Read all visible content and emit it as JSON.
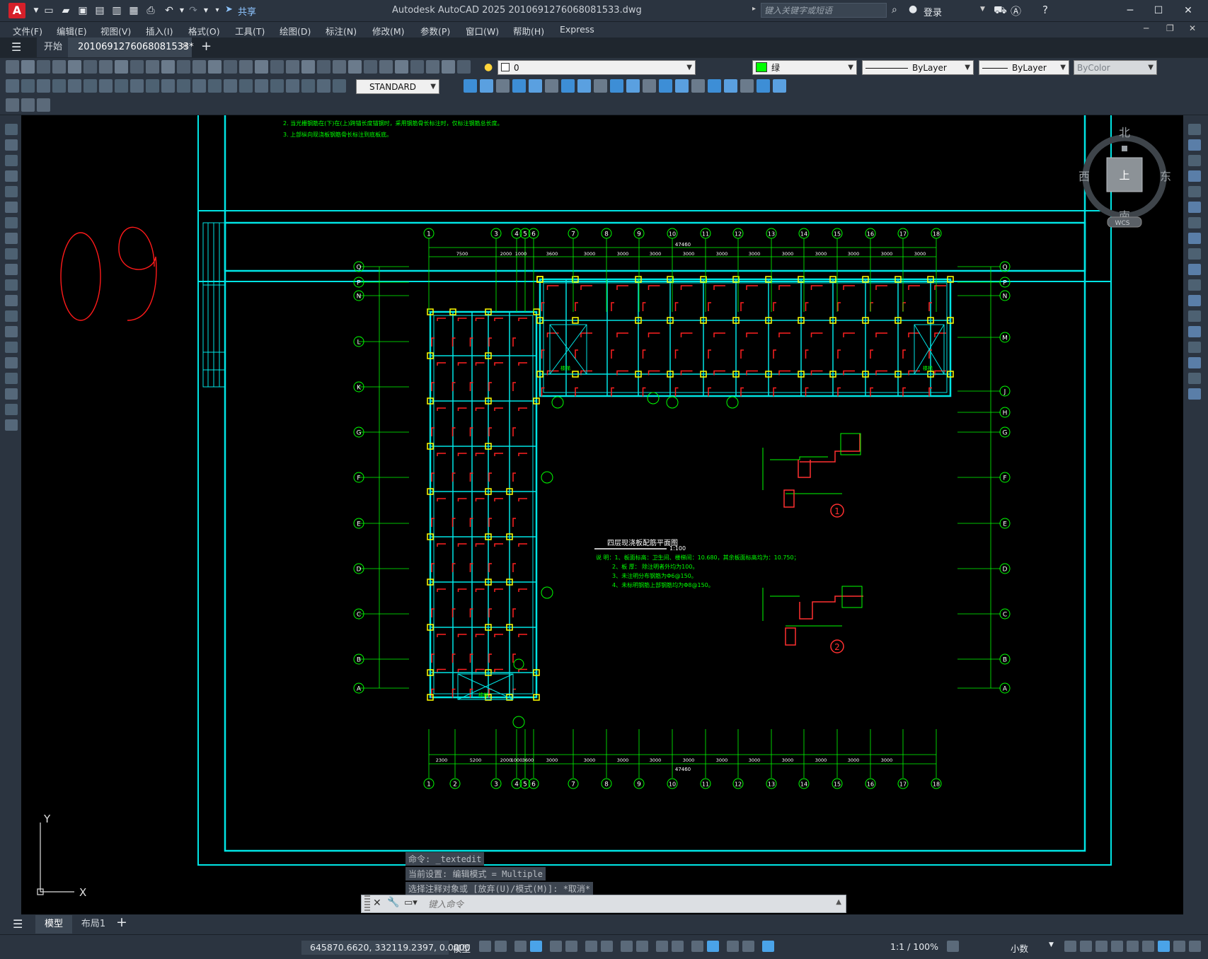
{
  "app": {
    "logo_letter": "A",
    "window_title": "Autodesk AutoCAD 2025    2010691276068081533.dwg",
    "share_label": "共享",
    "search_placeholder": "键入关键字或短语",
    "login_label": "登录"
  },
  "menu": [
    "文件(F)",
    "编辑(E)",
    "视图(V)",
    "插入(I)",
    "格式(O)",
    "工具(T)",
    "绘图(D)",
    "标注(N)",
    "修改(M)",
    "参数(P)",
    "窗口(W)",
    "帮助(H)",
    "Express"
  ],
  "tabs": {
    "start": "开始",
    "drawing": "2010691276068081533*"
  },
  "layer": {
    "name": "0"
  },
  "color_combo": {
    "name": "绿",
    "swatch": "#00ff00"
  },
  "linetype_combo": "ByLayer",
  "lineweight_combo": "ByLayer",
  "plotstyle_combo": "ByColor",
  "textstyle_combo": "STANDARD",
  "viewcube": {
    "north": "北",
    "south": "南",
    "east": "东",
    "west": "西",
    "face": "上",
    "wcs": "WCS"
  },
  "ucs": {
    "x": "X",
    "y": "Y"
  },
  "handwritten_number": "09",
  "drawing": {
    "notes_top": [
      "2. 当光栅钢筋在(下)在(上)跨锚长度锚钢时，采用钢筋骨长标注时，仅标注钢筋总长度。",
      "3. 上部纵向现浇板钢筋骨长标注到底板底。"
    ],
    "plan_title": "四层现浇板配筋平面图",
    "plan_scale": "1:100",
    "notes_main": [
      "说 明：1、板面标高：卫生间、楼梯间：10.680，其余板面标高均为：10.750；",
      "2、板 厚： 除注明者外均为100。",
      "3、未注明分布钢筋为Φ6@150。",
      "4、未标明钢筋上部钢筋均为Φ8@150。"
    ],
    "section_labels": [
      "1",
      "2"
    ],
    "top_axes": [
      "1",
      "3",
      "4",
      "5",
      "6",
      "7",
      "8",
      "9",
      "10",
      "11",
      "12",
      "13",
      "14",
      "15",
      "16",
      "17",
      "18"
    ],
    "bottom_axes": [
      "1",
      "2",
      "3",
      "4",
      "5",
      "6",
      "7",
      "8",
      "9",
      "10",
      "11",
      "12",
      "13",
      "14",
      "15",
      "16",
      "17",
      "18"
    ],
    "left_axes": [
      "Q",
      "P",
      "N",
      "L",
      "K",
      "G",
      "F",
      "E",
      "D",
      "C",
      "B",
      "A"
    ],
    "right_axes": [
      "Q",
      "P",
      "N",
      "M",
      "J",
      "H",
      "G",
      "F",
      "E",
      "D",
      "C",
      "B",
      "A"
    ],
    "top_dims": [
      "7500",
      "2000",
      "1000",
      "3600",
      "3000",
      "3000",
      "3000",
      "3000",
      "3000",
      "3000",
      "3000",
      "3000",
      "3000",
      "3000",
      "3000"
    ],
    "bottom_dims": [
      "2300",
      "5200",
      "2000",
      "1000",
      "3600",
      "3000",
      "3000",
      "3000",
      "3000",
      "3000",
      "3000",
      "3000",
      "3000",
      "3000",
      "3000",
      "3000"
    ],
    "total_dim": "47460",
    "stair_label": "楼梯"
  },
  "command": {
    "history": [
      "命令: _textedit",
      "当前设置: 编辑模式 = Multiple",
      "选择注释对象或 [放弃(U)/模式(M)]: *取消*"
    ],
    "placeholder": "键入命令"
  },
  "layout_tabs": [
    "模型",
    "布局1"
  ],
  "status": {
    "coords": "645870.6620, 332119.2397, 0.0000",
    "model_label": "模型",
    "scale": "1:1 / 100%",
    "units": "小数"
  }
}
